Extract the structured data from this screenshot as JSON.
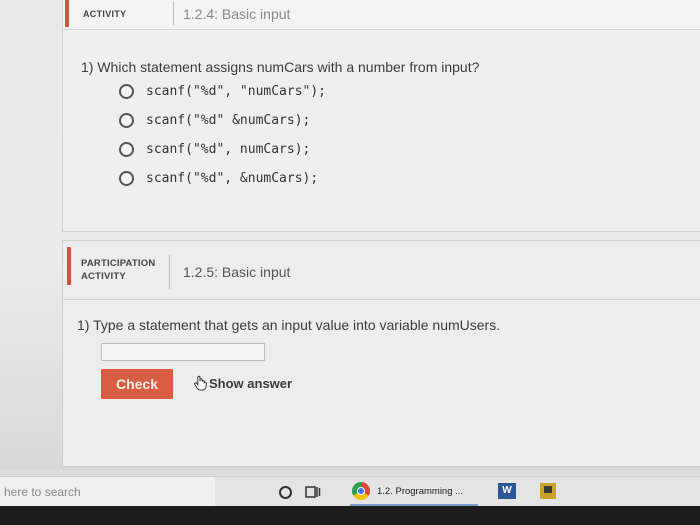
{
  "activity_1": {
    "type_label": "ACTIVITY",
    "title": "1.2.4: Basic input",
    "question": "1) Which statement assigns numCars with a number from input?",
    "choices": [
      "scanf(\"%d\", \"numCars\");",
      "scanf(\"%d\" &numCars);",
      "scanf(\"%d\", numCars);",
      "scanf(\"%d\", &numCars);"
    ]
  },
  "activity_2": {
    "type_label_line1": "PARTICIPATION",
    "type_label_line2": "ACTIVITY",
    "title": "1.2.5: Basic input",
    "question": "1) Type a statement that gets an input value into variable numUsers.",
    "input_value": "",
    "check_label": "Check",
    "show_answer_label": "Show answer"
  },
  "taskbar": {
    "search_text": "here to search",
    "chrome_label": "1.2. Programming ...",
    "word_label": "W"
  },
  "colors": {
    "accent": "#c9583f",
    "check_button": "#d85e43"
  }
}
